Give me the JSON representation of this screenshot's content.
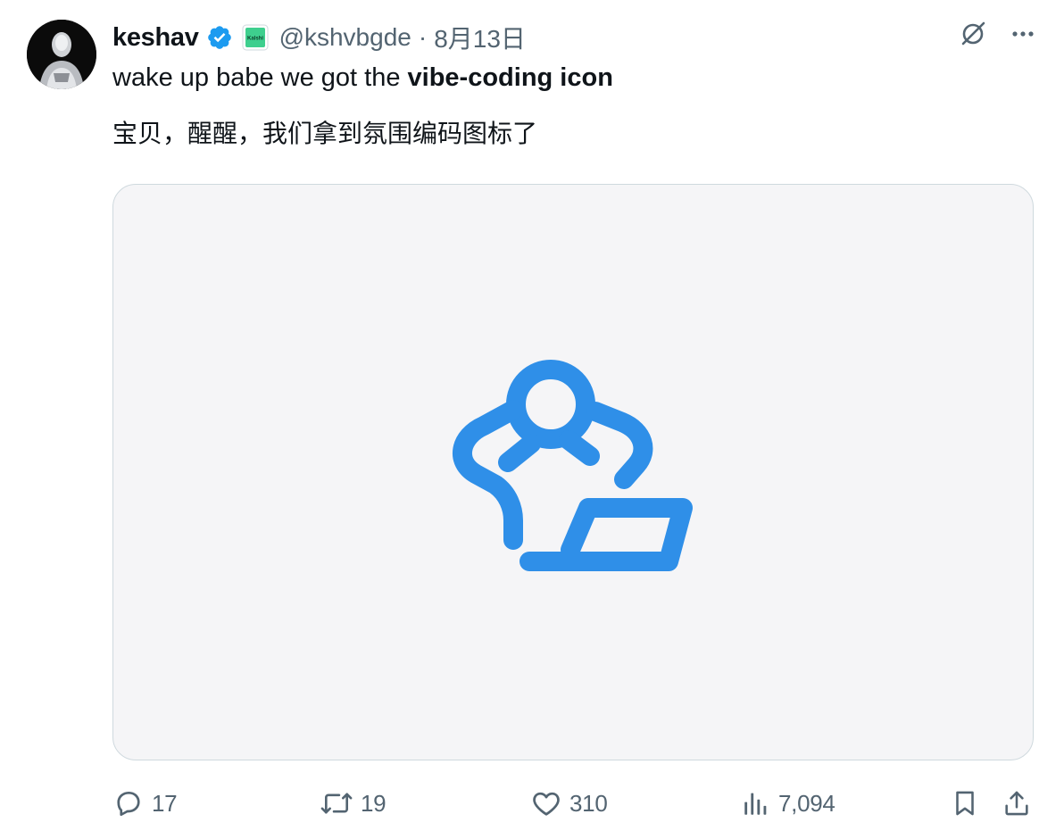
{
  "post": {
    "author_name": "keshav",
    "handle": "@kshvbgde",
    "separator": "·",
    "date": "8月13日",
    "affiliate_label": "Kalshi",
    "text_prefix": "wake up babe we got the ",
    "text_bold": "vibe-coding icon",
    "translation": "宝贝，醒醒，我们拿到氛围编码图标了"
  },
  "media": {
    "icon_name": "vibe-coding-icon",
    "background_color": "#f5f5f7",
    "icon_color": "#2f8fe8"
  },
  "actions": {
    "replies": "17",
    "reposts": "19",
    "likes": "310",
    "views": "7,094"
  },
  "colors": {
    "verified": "#1d9bf0",
    "secondary_text": "#536471",
    "affiliate_badge": "#3ecf8e"
  }
}
